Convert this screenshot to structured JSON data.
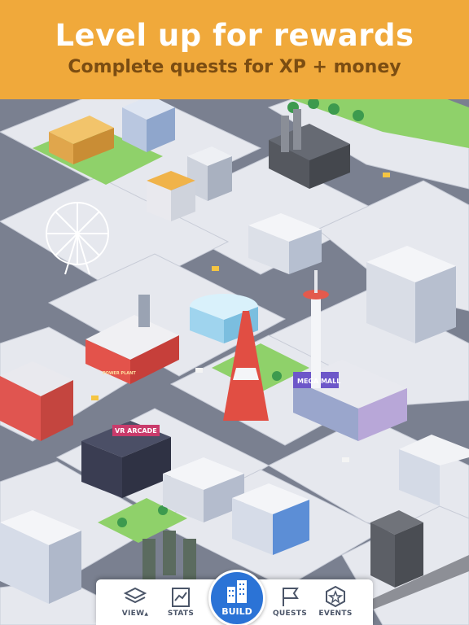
{
  "banner": {
    "title": "Level up for rewards",
    "subtitle": "Complete quests for XP + money",
    "background_color": "#f0a93b"
  },
  "scene": {
    "signs": {
      "arcade": "VR ARCADE",
      "mall": "MEGA MALL",
      "plant": "POWER PLANT",
      "arcade_label": "VR ARCADE"
    }
  },
  "toolbar": {
    "items": [
      {
        "label": "VIEW",
        "icon": "layers-icon"
      },
      {
        "label": "STATS",
        "icon": "chart-board-icon"
      },
      {
        "label": "BUILD",
        "icon": "buildings-icon"
      },
      {
        "label": "QUESTS",
        "icon": "flag-icon"
      },
      {
        "label": "EVENTS",
        "icon": "star-badge-icon"
      }
    ],
    "view_suffix": "▲",
    "build_color": "#2b73d6"
  }
}
